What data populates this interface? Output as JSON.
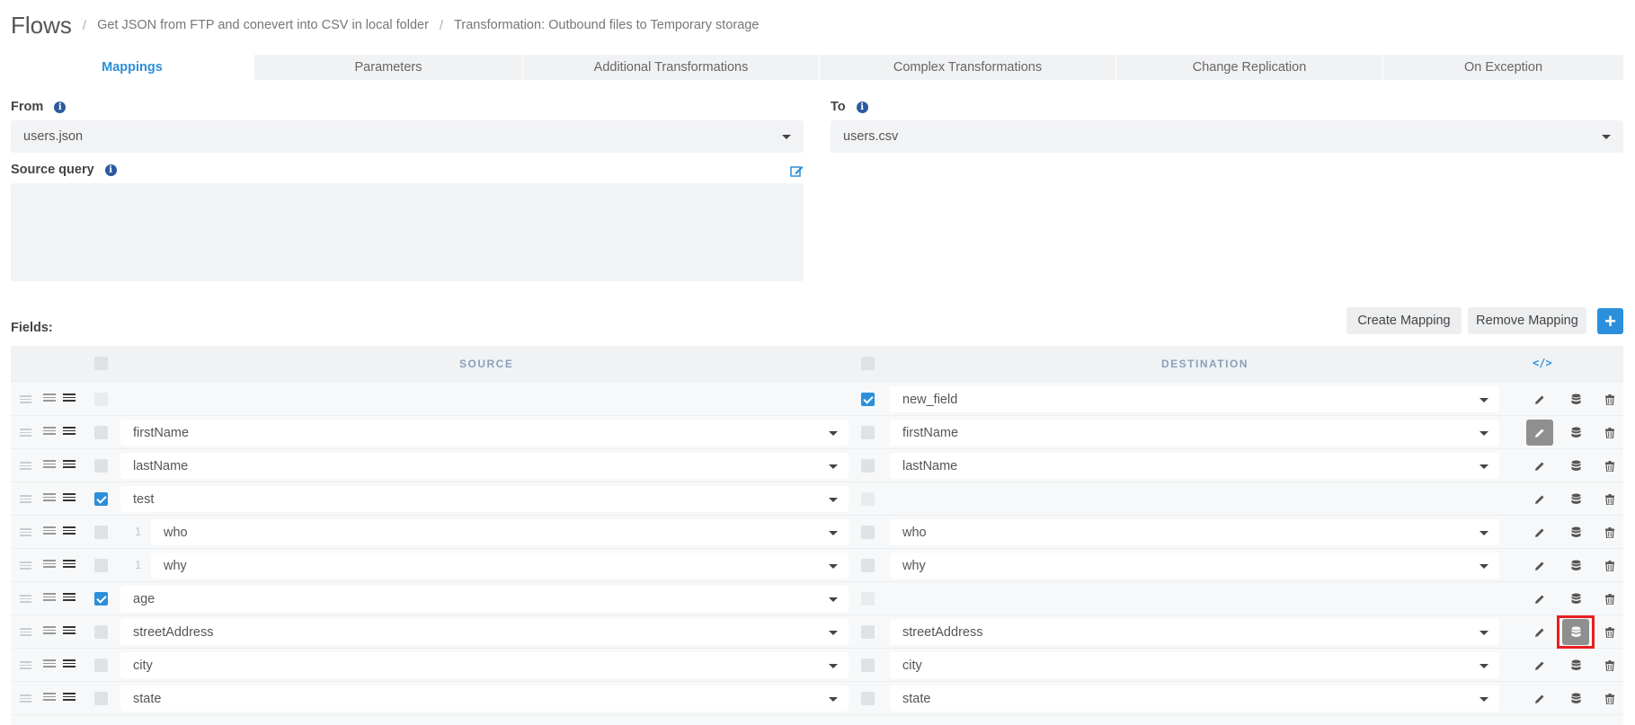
{
  "breadcrumb": {
    "root": "Flows",
    "items": [
      "Get JSON from FTP and conevert into CSV in local folder",
      "Transformation: Outbound files to Temporary storage"
    ],
    "separator": "/"
  },
  "tabs": [
    {
      "label": "Mappings",
      "active": true
    },
    {
      "label": "Parameters"
    },
    {
      "label": "Additional Transformations"
    },
    {
      "label": "Complex Transformations"
    },
    {
      "label": "Change Replication"
    },
    {
      "label": "On Exception"
    }
  ],
  "form": {
    "from_label": "From",
    "from_value": "users.json",
    "to_label": "To",
    "to_value": "users.csv",
    "source_query_label": "Source query",
    "source_query_value": ""
  },
  "fields": {
    "label": "Fields:",
    "create_mapping": "Create Mapping",
    "remove_mapping": "Remove Mapping",
    "add": "+"
  },
  "table": {
    "source_header": "SOURCE",
    "destination_header": "DESTINATION",
    "code_icon": "</>",
    "rows": [
      {
        "source": "",
        "source_checked": false,
        "dest": "new_field",
        "dest_checked": true,
        "level": ""
      },
      {
        "source": "firstName",
        "source_checked": false,
        "dest": "firstName",
        "dest_checked": false,
        "level": "",
        "edit_pressed": true
      },
      {
        "source": "lastName",
        "source_checked": false,
        "dest": "lastName",
        "dest_checked": false,
        "level": ""
      },
      {
        "source": "test",
        "source_checked": true,
        "dest": "",
        "dest_checked": false,
        "level": ""
      },
      {
        "source": "who",
        "source_checked": false,
        "dest": "who",
        "dest_checked": false,
        "level": "1"
      },
      {
        "source": "why",
        "source_checked": false,
        "dest": "why",
        "dest_checked": false,
        "level": "1"
      },
      {
        "source": "age",
        "source_checked": true,
        "dest": "",
        "dest_checked": false,
        "level": ""
      },
      {
        "source": "streetAddress",
        "source_checked": false,
        "dest": "streetAddress",
        "dest_checked": false,
        "level": "",
        "db_pressed": true
      },
      {
        "source": "city",
        "source_checked": false,
        "dest": "city",
        "dest_checked": false,
        "level": ""
      },
      {
        "source": "state",
        "source_checked": false,
        "dest": "state",
        "dest_checked": false,
        "level": ""
      }
    ]
  },
  "colors": {
    "accent": "#2b8fdb",
    "highlight": "#e8201f"
  }
}
